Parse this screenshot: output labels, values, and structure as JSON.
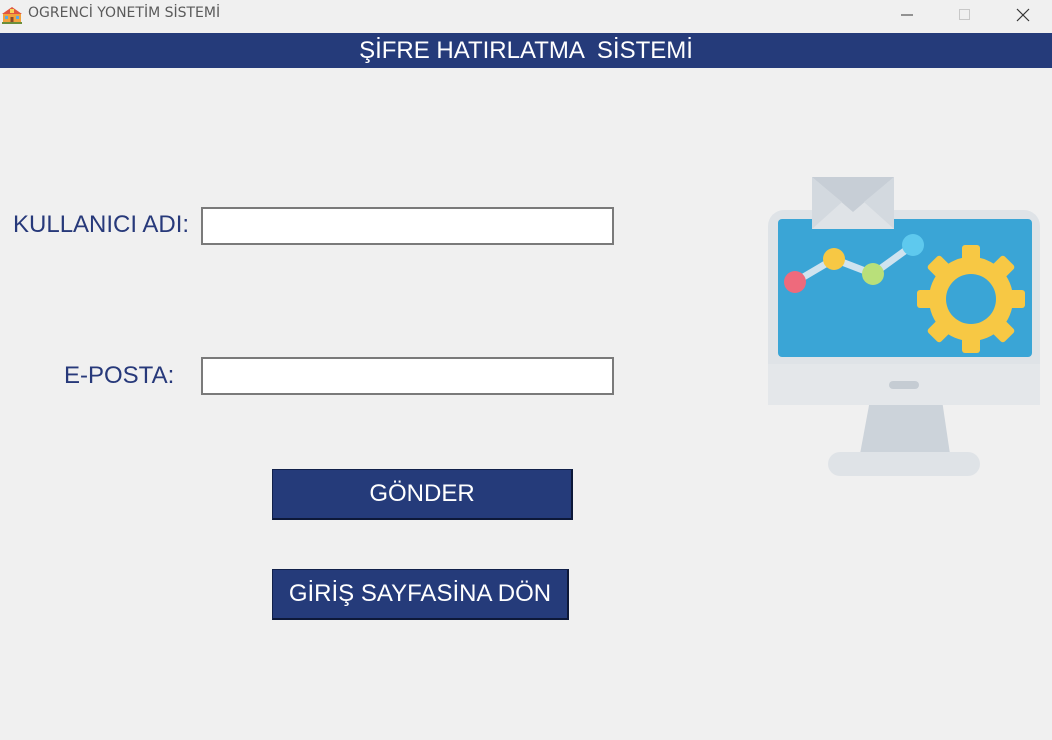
{
  "window": {
    "title": "OGRENCİ YONETİM SİSTEMİ"
  },
  "header": {
    "title": "ŞİFRE HATIRLATMA  SİSTEMİ"
  },
  "form": {
    "username_label": "KULLANICI ADI:",
    "username_value": "",
    "email_label": "E-POSTA:",
    "email_value": "",
    "send_button": "GÖNDER",
    "back_button": "GİRİŞ SAYFASİNA DÖN"
  },
  "colors": {
    "header_bg": "#253b7a",
    "label_text": "#27397a",
    "window_bg": "#f0f0f0"
  },
  "icons": {
    "app": "school-building-icon",
    "illustration": "computer-mail-settings-icon"
  }
}
